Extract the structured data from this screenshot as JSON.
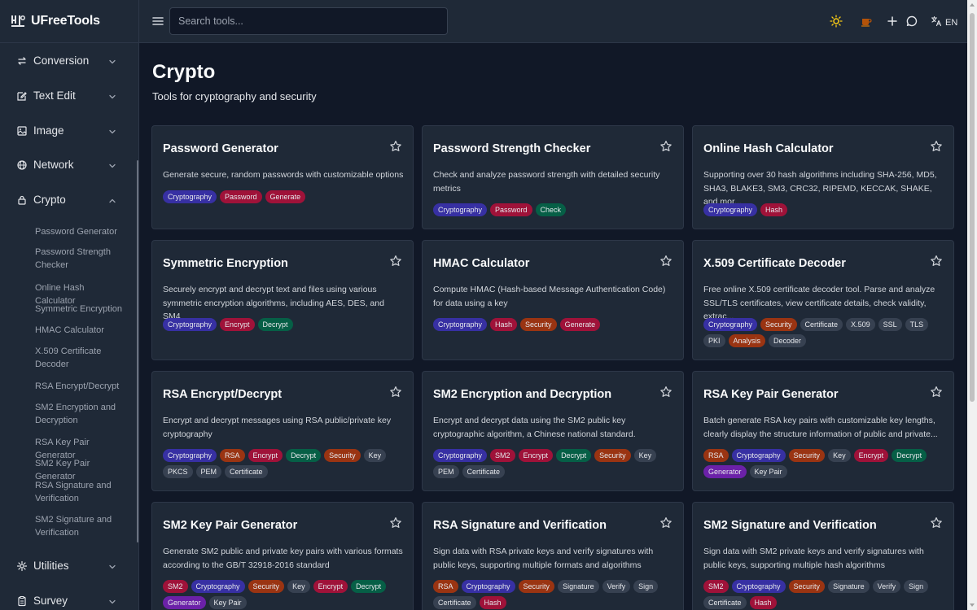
{
  "app": {
    "name": "UFreeTools"
  },
  "search": {
    "placeholder": "Search tools..."
  },
  "topbar": {
    "lang_label": "EN"
  },
  "sidebar": {
    "items": [
      {
        "label": "Conversion",
        "icon": "arrows-swap-icon",
        "expanded": false
      },
      {
        "label": "Text Edit",
        "icon": "edit-icon",
        "expanded": false
      },
      {
        "label": "Image",
        "icon": "image-icon",
        "expanded": false
      },
      {
        "label": "Network",
        "icon": "globe-icon",
        "expanded": false
      },
      {
        "label": "Crypto",
        "icon": "lock-icon",
        "expanded": true
      },
      {
        "label": "Utilities",
        "icon": "gear-icon",
        "expanded": false
      },
      {
        "label": "Survey",
        "icon": "clipboard-icon",
        "expanded": false
      }
    ],
    "crypto_sub": [
      "Password Generator",
      "Password Strength Checker",
      "Online Hash Calculator",
      "Symmetric Encryption",
      "HMAC Calculator",
      "X.509 Certificate Decoder",
      "RSA Encrypt/Decrypt",
      "SM2 Encryption and Decryption",
      "RSA Key Pair Generator",
      "SM2 Key Pair Generator",
      "RSA Signature and Verification",
      "SM2 Signature and Verification"
    ]
  },
  "main": {
    "title": "Crypto",
    "subtitle": "Tools for cryptography and security",
    "cards": [
      {
        "title": "Password Generator",
        "desc": "Generate secure, random passwords with customizable options",
        "tags": [
          "Cryptography",
          "Password",
          "Generate"
        ]
      },
      {
        "title": "Password Strength Checker",
        "desc": "Check and analyze password strength with detailed security metrics",
        "tags": [
          "Cryptography",
          "Password",
          "Check"
        ]
      },
      {
        "title": "Online Hash Calculator",
        "desc": "Supporting over 30 hash algorithms including SHA-256, MD5, SHA3, BLAKE3, SM3, CRC32, RIPEMD, KECCAK, SHAKE, and mor...",
        "tags": [
          "Cryptography",
          "Hash"
        ]
      },
      {
        "title": "Symmetric Encryption",
        "desc": "Securely encrypt and decrypt text and files using various symmetric encryption algorithms, including AES, DES, and SM4",
        "tags": [
          "Cryptography",
          "Encrypt",
          "Decrypt"
        ]
      },
      {
        "title": "HMAC Calculator",
        "desc": "Compute HMAC (Hash-based Message Authentication Code) for data using a key",
        "tags": [
          "Cryptography",
          "Hash",
          "Security",
          "Generate"
        ]
      },
      {
        "title": "X.509 Certificate Decoder",
        "desc": "Free online X.509 certificate decoder tool. Parse and analyze SSL/TLS certificates, view certificate details, check validity, extrac...",
        "tags": [
          "Cryptography",
          "Security",
          "Certificate",
          "X.509",
          "SSL",
          "TLS",
          "PKI",
          "Analysis",
          "Decoder"
        ]
      },
      {
        "title": "RSA Encrypt/Decrypt",
        "desc": "Encrypt and decrypt messages using RSA public/private key cryptography",
        "tags": [
          "Cryptography",
          "RSA",
          "Encrypt",
          "Decrypt",
          "Security",
          "Key",
          "PKCS",
          "PEM",
          "Certificate"
        ]
      },
      {
        "title": "SM2 Encryption and Decryption",
        "desc": "Encrypt and decrypt data using the SM2 public key cryptographic algorithm, a Chinese national standard.",
        "tags": [
          "Cryptography",
          "SM2",
          "Encrypt",
          "Decrypt",
          "Security",
          "Key",
          "PEM",
          "Certificate"
        ]
      },
      {
        "title": "RSA Key Pair Generator",
        "desc": "Batch generate RSA key pairs with customizable key lengths, clearly display the structure information of public and private...",
        "tags": [
          "RSA",
          "Cryptography",
          "Security",
          "Key",
          "Encrypt",
          "Decrypt",
          "Generator",
          "Key Pair"
        ]
      },
      {
        "title": "SM2 Key Pair Generator",
        "desc": "Generate SM2 public and private key pairs with various formats according to the GB/T 32918-2016 standard",
        "tags": [
          "SM2",
          "Cryptography",
          "Security",
          "Key",
          "Encrypt",
          "Decrypt",
          "Generator",
          "Key Pair"
        ]
      },
      {
        "title": "RSA Signature and Verification",
        "desc": "Sign data with RSA private keys and verify signatures with public keys, supporting multiple formats and algorithms",
        "tags": [
          "RSA",
          "Cryptography",
          "Security",
          "Signature",
          "Verify",
          "Sign",
          "Certificate",
          "Hash"
        ]
      },
      {
        "title": "SM2 Signature and Verification",
        "desc": "Sign data with SM2 private keys and verify signatures with public keys, supporting multiple hash algorithms",
        "tags": [
          "SM2",
          "Cryptography",
          "Security",
          "Signature",
          "Verify",
          "Sign",
          "Certificate",
          "Hash"
        ]
      }
    ]
  },
  "tag_colors": {
    "Cryptography": "#3730a3",
    "Password": "#9f1239",
    "Generate": "#9f1239",
    "Check": "#065f46",
    "Hash": "#9f1239",
    "Encrypt": "#9f1239",
    "Decrypt": "#065f46",
    "Security": "#9a3412",
    "RSA": "#9a3412",
    "SM2": "#9f1239",
    "Analysis": "#9a3412",
    "Generator": "#6b21a8",
    "default": "#374151"
  }
}
